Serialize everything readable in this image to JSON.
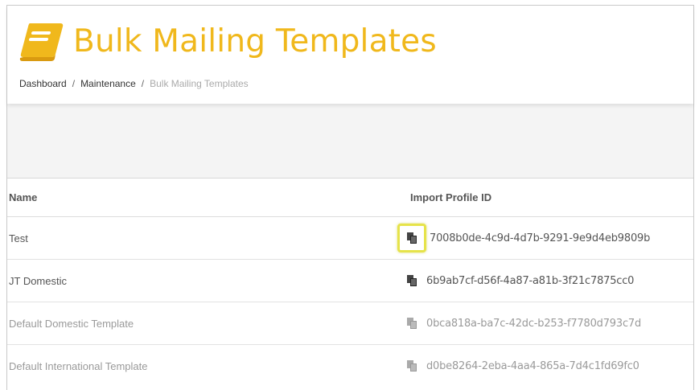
{
  "header": {
    "title": "Bulk Mailing Templates",
    "icon": "book-icon",
    "accent_color": "#f0b81c"
  },
  "breadcrumb": {
    "items": [
      "Dashboard",
      "Maintenance",
      "Bulk Mailing Templates"
    ],
    "separator": "/"
  },
  "table": {
    "columns": [
      "Name",
      "Import Profile ID"
    ],
    "rows": [
      {
        "name": "Test",
        "id": "7008b0de-4c9d-4d7b-9291-9e9d4eb9809b",
        "highlighted": true
      },
      {
        "name": "JT Domestic",
        "id": "6b9ab7cf-d56f-4a87-a81b-3f21c7875cc0",
        "highlighted": false
      },
      {
        "name": "Default Domestic Template",
        "id": "0bca818a-ba7c-42dc-b253-f7780d793c7d",
        "highlighted": false
      },
      {
        "name": "Default International Template",
        "id": "d0be8264-2eba-4aa4-865a-7d4c1fd69fc0",
        "highlighted": false
      }
    ],
    "copy_icon": "copy-icon",
    "highlight_color": "#e6e34a"
  }
}
